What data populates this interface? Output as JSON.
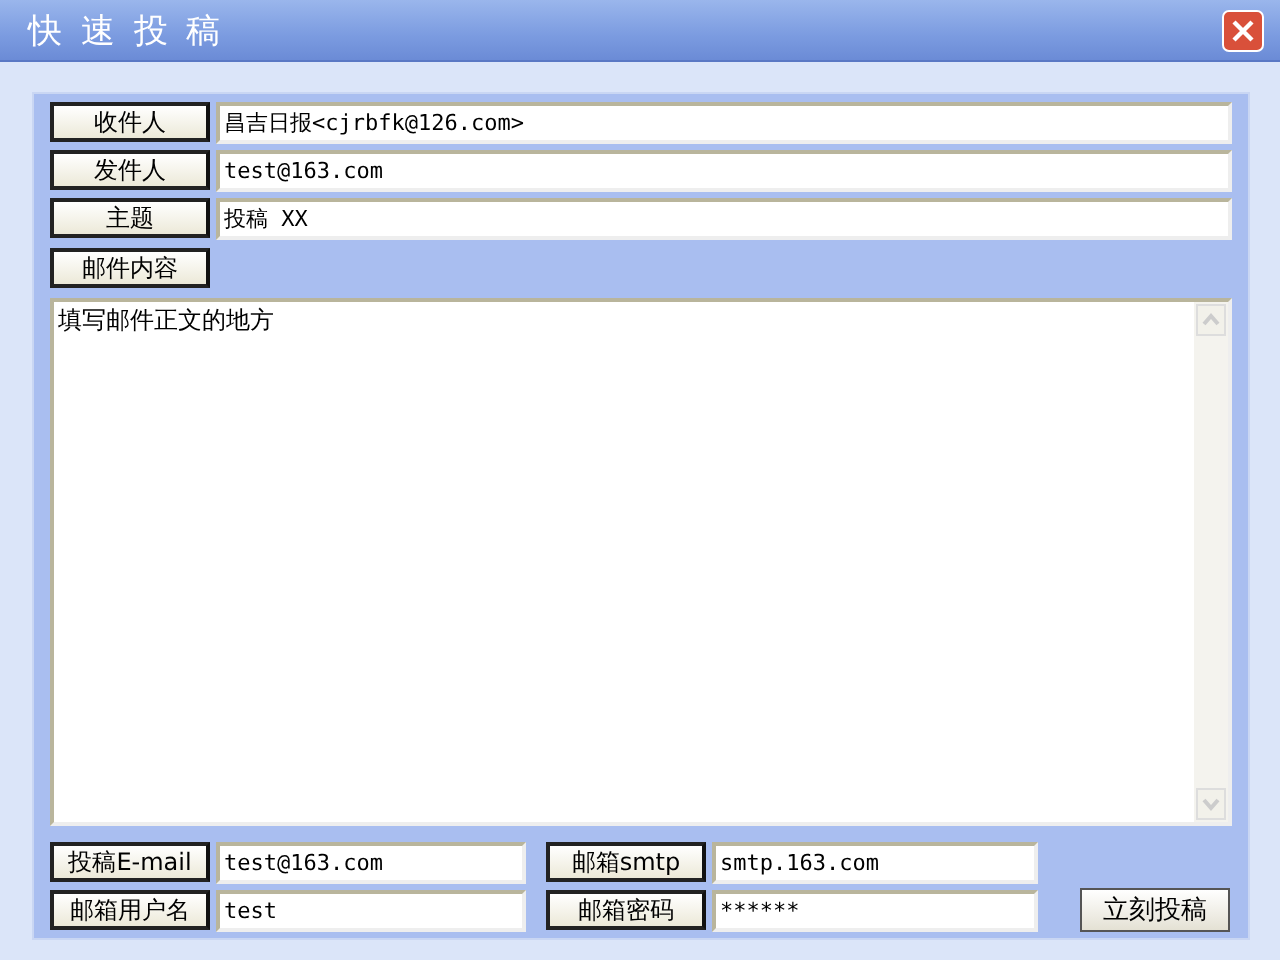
{
  "window": {
    "title": "快 速 投 稿"
  },
  "header_fields": [
    {
      "label": "收件人",
      "value": "昌吉日报<cjrbfk@126.com>"
    },
    {
      "label": "发件人",
      "value": "test@163.com"
    },
    {
      "label": "主题",
      "value": "投稿 XX"
    }
  ],
  "body": {
    "label": "邮件内容",
    "value": "填写邮件正文的地方"
  },
  "account_fields": [
    {
      "label": "投稿E-mail",
      "value": "test@163.com"
    },
    {
      "label": "邮箱smtp",
      "value": "smtp.163.com"
    },
    {
      "label": "邮箱用户名",
      "value": "test"
    },
    {
      "label": "邮箱密码",
      "value": "******"
    }
  ],
  "submit": "立刻投稿"
}
